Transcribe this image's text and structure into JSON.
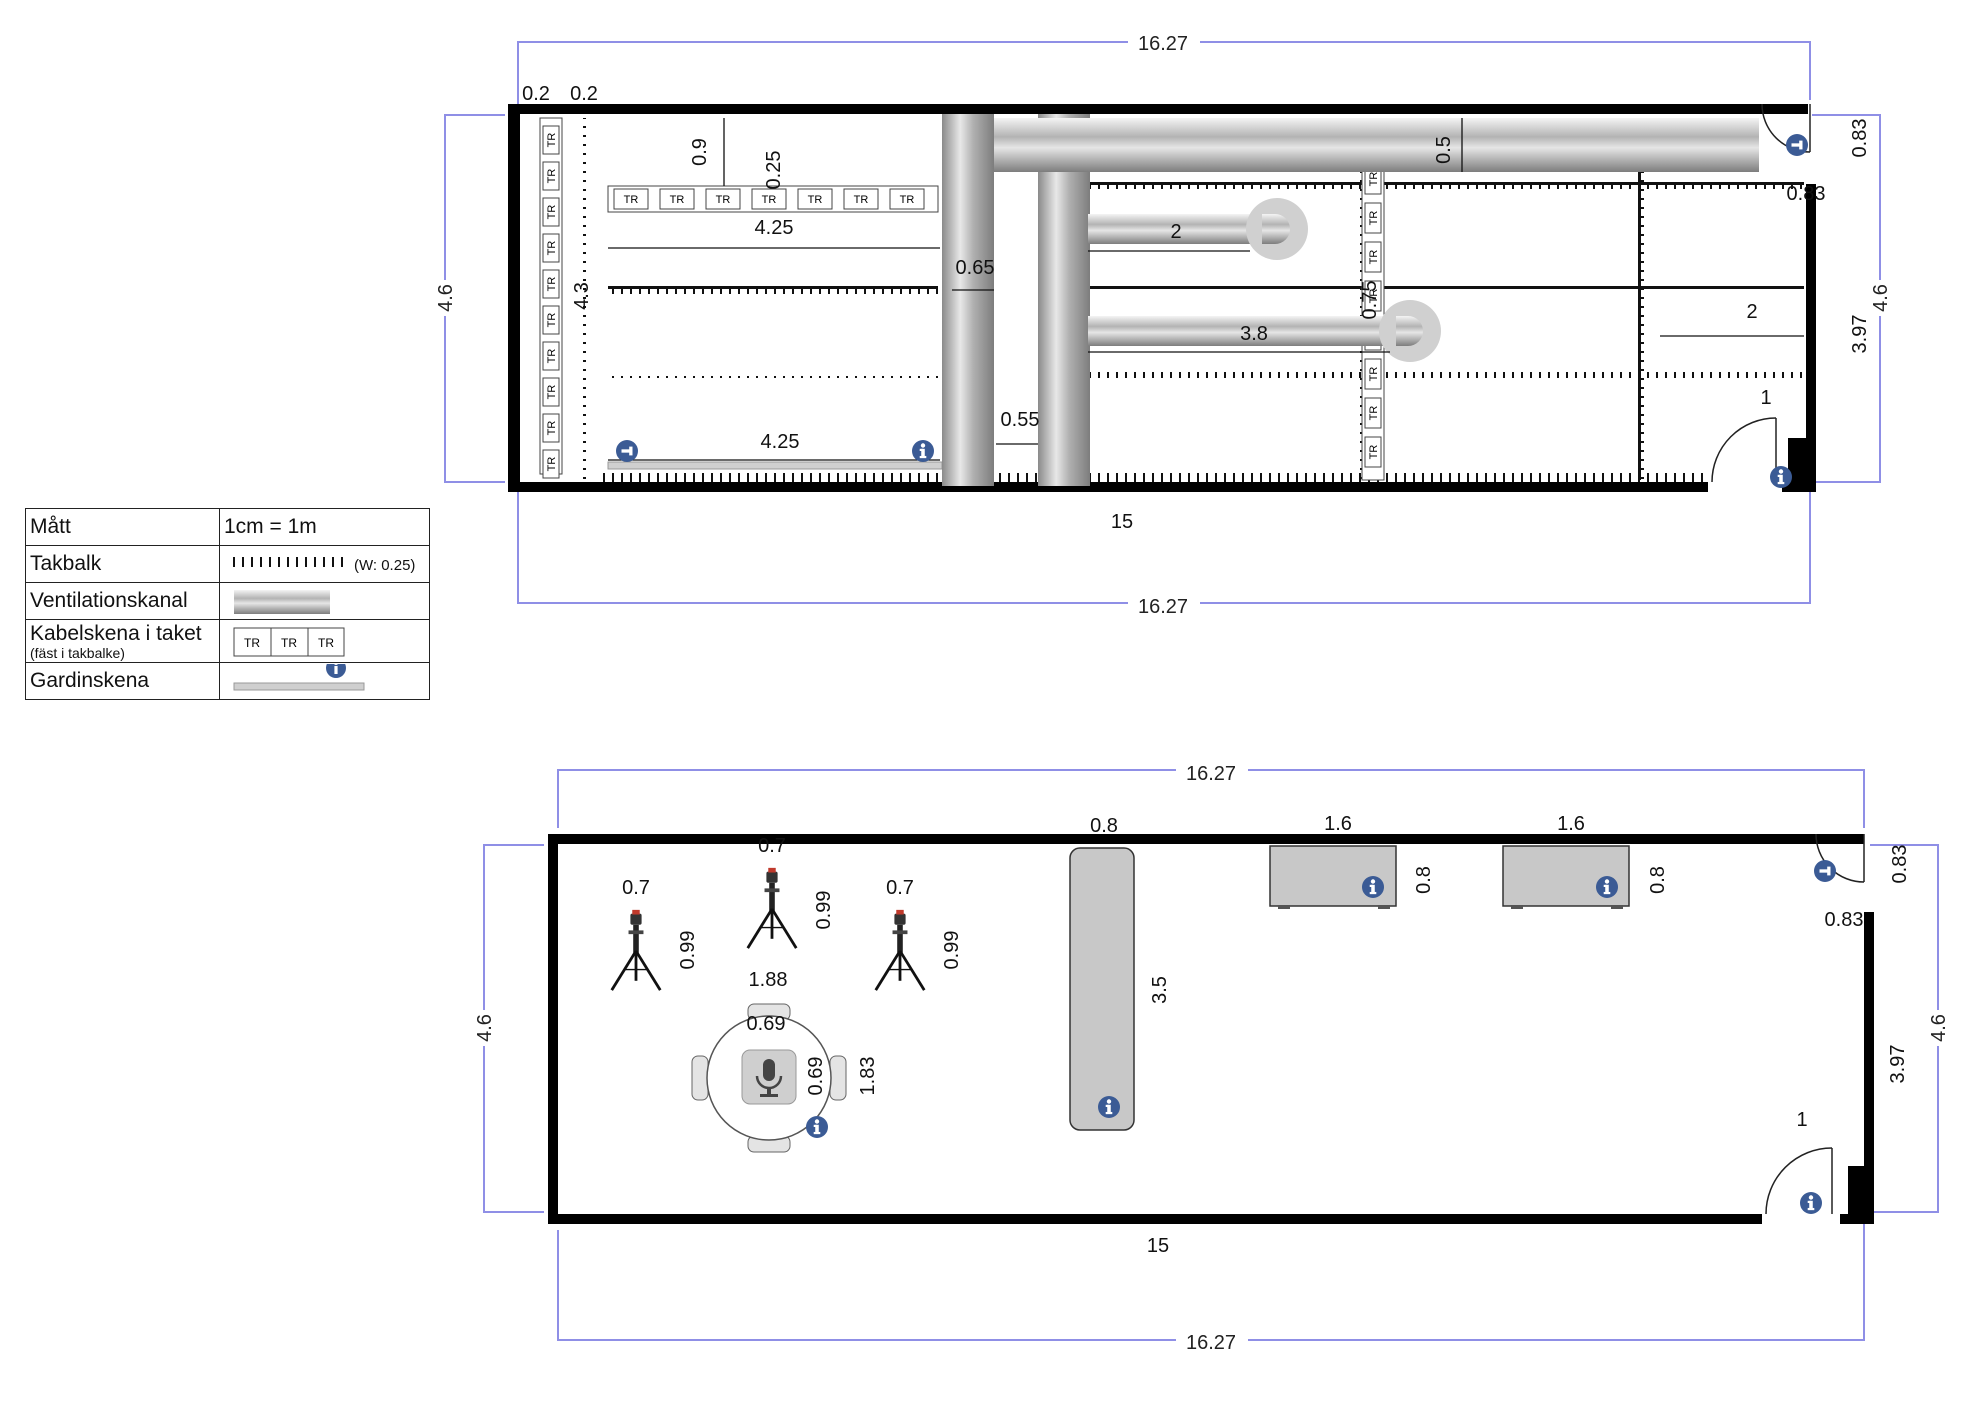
{
  "legend": {
    "rows": [
      {
        "label": "Mått",
        "value": "1cm = 1m"
      },
      {
        "label": "Takbalk",
        "value": "(W: 0.25)"
      },
      {
        "label": "Ventilationskanal",
        "value": ""
      },
      {
        "label": "Kabelskena i taket",
        "sublabel": "(fäst i takbalke)",
        "value": ""
      },
      {
        "label": "Gardinskena",
        "value": ""
      }
    ],
    "tr_text": "TR"
  },
  "plan_ceiling": {
    "dims": {
      "top_total": "16.27",
      "bottom_total": "16.27",
      "bottom_inner": "15",
      "left_height": "4.6",
      "right_height": "4.6",
      "right_inner": "3.97",
      "door_top": "0.83",
      "door_top_width": "0.83",
      "door_bottom": "1",
      "wall_left_a": "0.2",
      "wall_left_b": "0.2",
      "rail_top": "4.25",
      "rail_bottom": "4.25",
      "rail_vertical": "4.3",
      "gap_09": "0.9",
      "gap_025": "0.25",
      "gap_05": "0.5",
      "duct_065": "0.65",
      "duct_055": "0.55",
      "duct_2": "2",
      "duct_38": "3.8",
      "beam_2": "2",
      "beam_075": "0.75"
    }
  },
  "plan_floor": {
    "dims": {
      "top_total": "16.27",
      "bottom_total": "16.27",
      "bottom_inner": "15",
      "left_height": "4.6",
      "right_height": "4.6",
      "right_inner": "3.97",
      "door_top": "0.83",
      "door_top_width": "0.83",
      "door_bottom": "1",
      "tripod_1_w": "0.7",
      "tripod_1_h": "0.99",
      "tripod_2_w": "0.7",
      "tripod_2_h": "0.99",
      "tripod_3_w": "0.7",
      "tripod_3_h": "0.99",
      "table_group_w": "1.88",
      "table_group_h": "1.83",
      "table_w": "0.69",
      "table_h": "0.69",
      "long_table_w": "0.8",
      "long_table_h": "3.5",
      "desk_1_w": "1.6",
      "desk_1_h": "0.8",
      "desk_2_w": "1.6",
      "desk_2_h": "0.8"
    }
  },
  "colors": {
    "wall": "#000000",
    "dimension_line": "#8f8fe6",
    "info_icon": "#3b5b95",
    "furniture": "#c8c8c8",
    "duct_light": "#f2f2f2",
    "duct_dark": "#8a8a8a"
  },
  "icons": [
    "info-icon",
    "door-exit-icon",
    "tripod-camera-icon",
    "microphone-icon",
    "chair-icon"
  ]
}
